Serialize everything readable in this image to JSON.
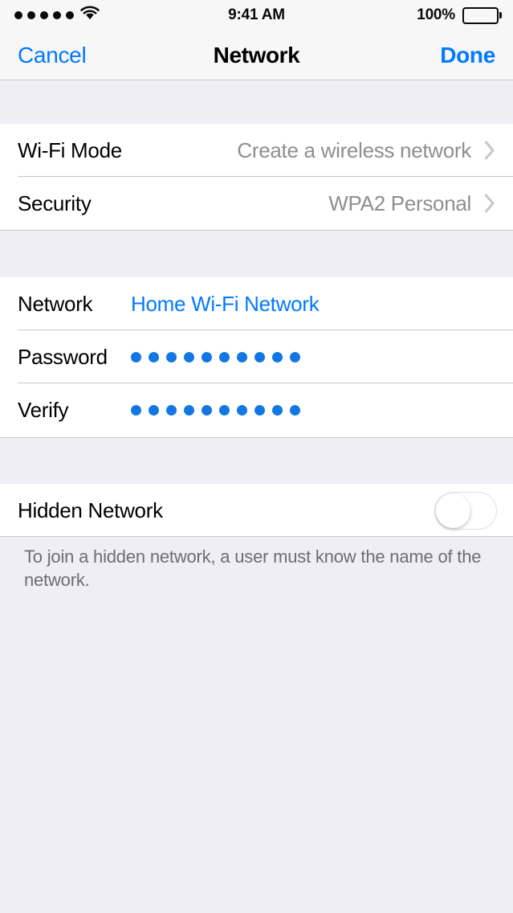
{
  "status_bar": {
    "signal_dots": 5,
    "wifi_icon": "wifi-icon",
    "time": "9:41 AM",
    "battery_percent": "100%",
    "battery_icon": "battery-full-icon"
  },
  "nav_bar": {
    "cancel_label": "Cancel",
    "title": "Network",
    "done_label": "Done"
  },
  "groups": [
    {
      "rows": [
        {
          "label": "Wi-Fi Mode",
          "value": "Create a wireless network",
          "type": "disclosure",
          "chevron": "chevron-right-icon"
        },
        {
          "label": "Security",
          "value": "WPA2 Personal",
          "type": "disclosure",
          "chevron": "chevron-right-icon"
        }
      ]
    },
    {
      "rows": [
        {
          "label": "Network",
          "value": "Home Wi-Fi Network",
          "type": "text-field"
        },
        {
          "label": "Password",
          "value": "••••••••••",
          "masked_dots": 10,
          "type": "secure-field"
        },
        {
          "label": "Verify",
          "value": "••••••••••",
          "masked_dots": 10,
          "type": "secure-field"
        }
      ]
    },
    {
      "rows": [
        {
          "label": "Hidden Network",
          "type": "switch",
          "switch_on": false
        }
      ],
      "footer": "To join a hidden network, a user must know the name of the network."
    }
  ],
  "colors": {
    "accent": "#007AFF",
    "dots": "#1277E2",
    "value_gray": "#8E8E93",
    "footer_gray": "#6D6D72",
    "group_bg": "#FFFFFF",
    "page_bg": "#EFEEF3",
    "bar_bg": "#F7F7F7",
    "separator": "#C8C7CC"
  }
}
